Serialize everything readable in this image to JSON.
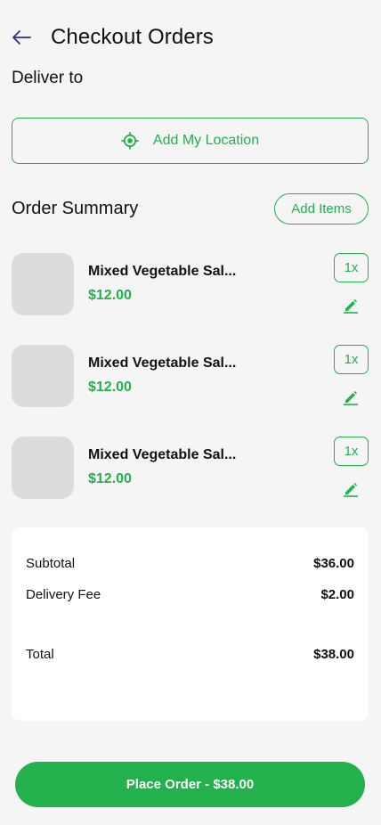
{
  "header": {
    "title": "Checkout Orders",
    "back_icon": "arrow-left-icon"
  },
  "deliver": {
    "label": "Deliver to",
    "location_button": "Add My Location",
    "location_icon": "crosshair-icon"
  },
  "summary": {
    "title": "Order Summary",
    "add_items": "Add Items",
    "items": [
      {
        "name": "Mixed Vegetable Sal...",
        "price": "$12.00",
        "qty": "1x"
      },
      {
        "name": "Mixed Vegetable Sal...",
        "price": "$12.00",
        "qty": "1x"
      },
      {
        "name": "Mixed Vegetable Sal...",
        "price": "$12.00",
        "qty": "1x"
      }
    ]
  },
  "totals": {
    "subtotal_label": "Subtotal",
    "subtotal": "$36.00",
    "fee_label": "Delivery Fee",
    "fee": "$2.00",
    "total_label": "Total",
    "total": "$38.00"
  },
  "cta": {
    "label": "Place Order - $38.00"
  },
  "colors": {
    "accent": "#22b14c",
    "background": "#f5f5f5",
    "back_arrow": "#2b2f8c"
  }
}
